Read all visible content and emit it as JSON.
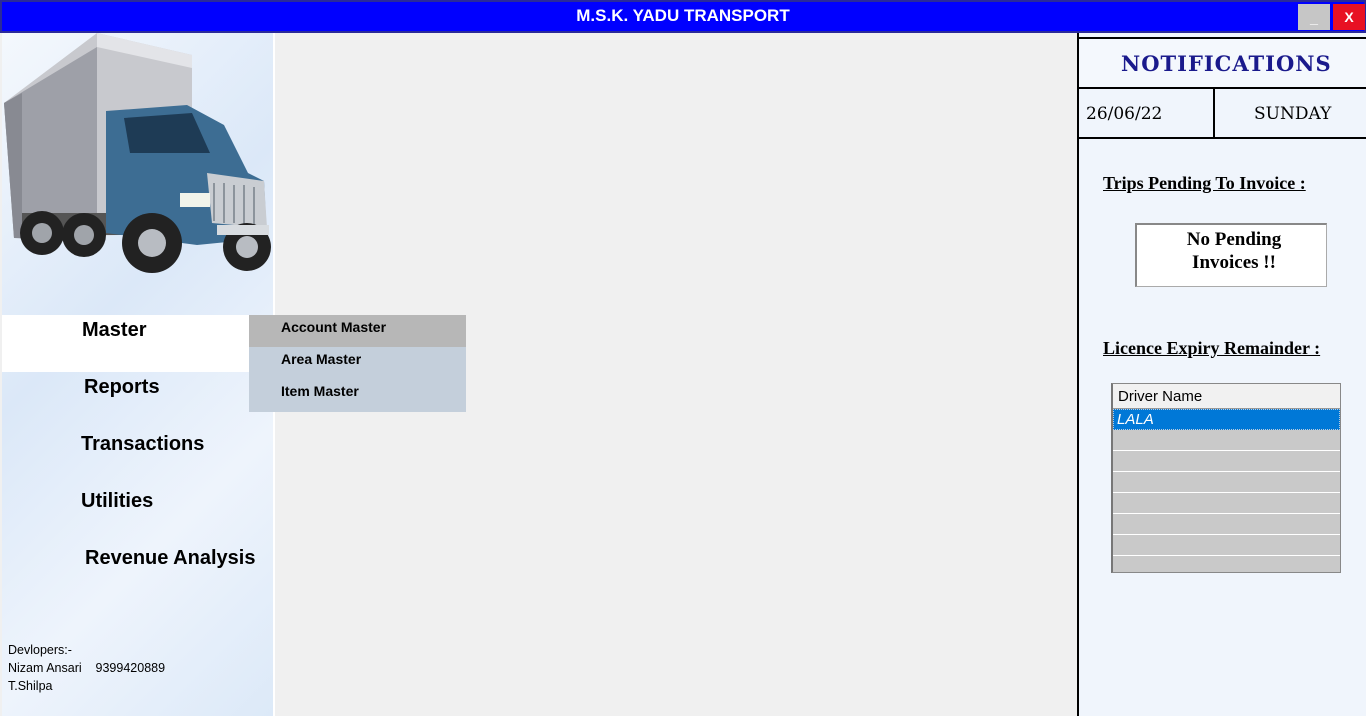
{
  "window": {
    "title": "M.S.K. YADU TRANSPORT",
    "minimize_label": "_",
    "close_label": "X"
  },
  "sidebar": {
    "menu": [
      {
        "label": "Master"
      },
      {
        "label": "Reports"
      },
      {
        "label": "Transactions"
      },
      {
        "label": "Utilities"
      },
      {
        "label": "Revenue Analysis"
      }
    ],
    "submenu": [
      {
        "label": "Account Master"
      },
      {
        "label": "Area Master"
      },
      {
        "label": "Item Master"
      }
    ],
    "developers": {
      "heading": "Devlopers:-",
      "line1": "Nizam Ansari    9399420889",
      "line2": "T.Shilpa"
    }
  },
  "notifications": {
    "title": "NOTIFICATIONS",
    "date": "26/06/22",
    "day": "SUNDAY",
    "trips_heading": "Trips Pending To Invoice :",
    "trips_message": "No   Pending Invoices  !!",
    "licence_heading": "Licence Expiry Remainder :",
    "grid": {
      "column": "Driver Name",
      "rows": [
        "LALA",
        "",
        "",
        "",
        "",
        "",
        "",
        ""
      ]
    }
  },
  "colors": {
    "titlebar": "#0000ff",
    "selection": "#0078d7",
    "close": "#e81123"
  }
}
